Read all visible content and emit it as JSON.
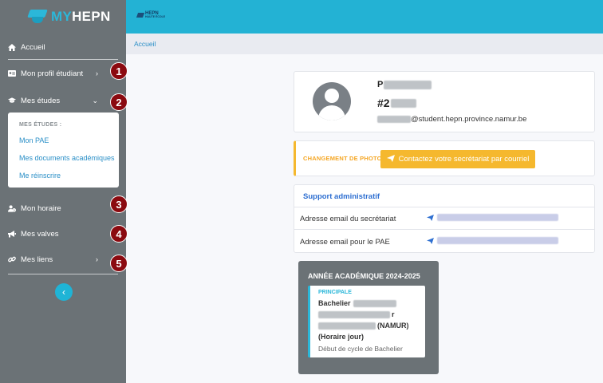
{
  "brand": {
    "part1": "MY",
    "part2": "HEPN"
  },
  "topbar": {
    "logo_text": "HEPN",
    "logo_sub": "HAUTE ÉCOLE"
  },
  "breadcrumb": "Accueil",
  "sidebar": {
    "items": [
      {
        "label": "Accueil",
        "icon": "home-icon"
      },
      {
        "label": "Mon profil étudiant",
        "icon": "id-card-icon"
      },
      {
        "label": "Mes études",
        "icon": "graduation-cap-icon"
      },
      {
        "label": "Mon horaire",
        "icon": "user-clock-icon"
      },
      {
        "label": "Mes valves",
        "icon": "megaphone-icon"
      },
      {
        "label": "Mes liens",
        "icon": "link-icon"
      }
    ],
    "submenu": {
      "title": "MES ÉTUDES :",
      "links": [
        "Mon PAE",
        "Mes documents académiques",
        "Me réinscrire"
      ]
    },
    "badges": [
      "1",
      "2",
      "3",
      "4",
      "5"
    ],
    "collapse_symbol": "‹"
  },
  "profile": {
    "name_initial": "P",
    "id_prefix": "#2",
    "email_suffix": "@student.hepn.province.namur.be"
  },
  "photo": {
    "label": "CHANGEMENT DE PHOTO",
    "button": "Contactez votre secrétariat par courriel"
  },
  "support": {
    "title": "Support administratif",
    "rows": [
      {
        "key": "Adresse email du secrétariat"
      },
      {
        "key": "Adresse email pour le PAE"
      }
    ]
  },
  "academic": {
    "title": "ANNÉE ACADÉMIQUE 2024-2025",
    "tag": "PRINCIPALE",
    "line1": "Bachelier",
    "line2_suffix": "r",
    "line3_suffix": "(NAMUR)",
    "line4": "(Horaire jour)",
    "line5": "Début de cycle de Bachelier"
  },
  "colors": {
    "sidebar": "#6b7276",
    "topbar": "#23b2d4",
    "accent": "#2bb7d9",
    "warning": "#f5b82e",
    "badge": "#8b0a10",
    "link": "#2e6fd1"
  }
}
